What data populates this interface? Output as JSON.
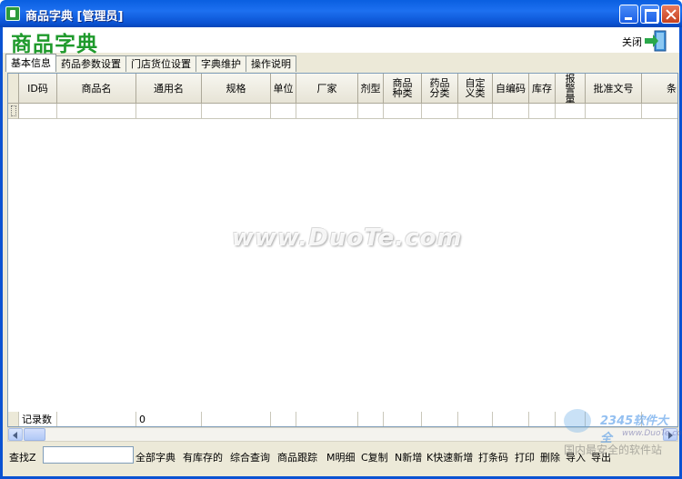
{
  "window": {
    "title": "商品字典 [管理员]"
  },
  "header": {
    "page_title": "商品字典",
    "close_label": "关闭"
  },
  "tabs": [
    {
      "label": "基本信息",
      "active": true
    },
    {
      "label": "药品参数设置",
      "active": false
    },
    {
      "label": "门店货位设置",
      "active": false
    },
    {
      "label": "字典维护",
      "active": false
    },
    {
      "label": "操作说明",
      "active": false
    }
  ],
  "grid": {
    "columns": [
      "ID码",
      "商品名",
      "通用名",
      "规格",
      "单位",
      "厂家",
      "剂型",
      "商品种类",
      "药品分类",
      "自定义类",
      "自编码",
      "库存",
      "报警量",
      "批准文号",
      "条"
    ],
    "footer": {
      "record_label": "记录数",
      "record_count": "0"
    }
  },
  "toolbar": {
    "find_label": "查找Z",
    "find_value": "",
    "buttons": [
      "全部字典",
      "有库存的",
      "综合查询",
      "商品跟踪",
      "M明细",
      "C复制",
      "N新增",
      "K快速新增",
      "打条码",
      "打印",
      "删除",
      "导入",
      "导出"
    ]
  },
  "watermarks": {
    "center": "www.DuoTe.com",
    "corner_logo": "2345软件大全",
    "corner_site": "www.DuoTe.com",
    "corner_slogan": "国内最安全的软件站"
  }
}
